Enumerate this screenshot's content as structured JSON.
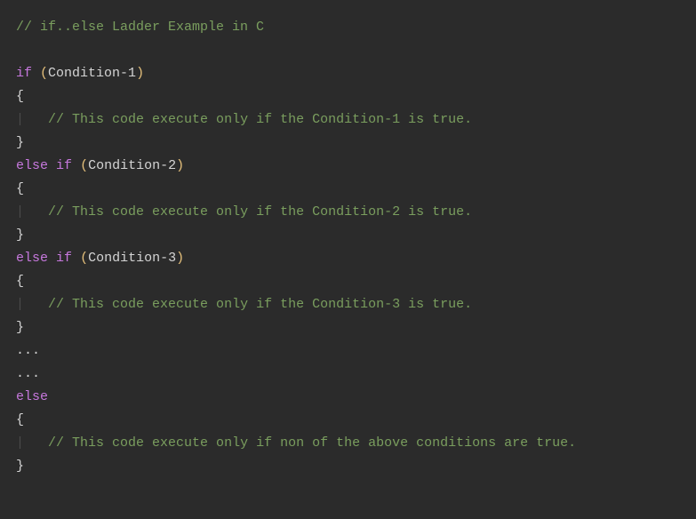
{
  "code": {
    "lines": [
      {
        "tokens": [
          {
            "cls": "comment",
            "text": "// if..else Ladder Example in C"
          }
        ]
      },
      {
        "tokens": []
      },
      {
        "tokens": [
          {
            "cls": "keyword",
            "text": "if"
          },
          {
            "cls": "default",
            "text": " "
          },
          {
            "cls": "paren",
            "text": "("
          },
          {
            "cls": "identifier",
            "text": "Condition-1"
          },
          {
            "cls": "paren",
            "text": ")"
          }
        ]
      },
      {
        "tokens": [
          {
            "cls": "brace",
            "text": "{"
          }
        ]
      },
      {
        "tokens": [
          {
            "cls": "indent-guide",
            "text": "|"
          },
          {
            "cls": "default",
            "text": "   "
          },
          {
            "cls": "comment",
            "text": "// This code execute only if the Condition-1 is true."
          }
        ]
      },
      {
        "tokens": [
          {
            "cls": "brace",
            "text": "}"
          }
        ]
      },
      {
        "tokens": [
          {
            "cls": "keyword",
            "text": "else"
          },
          {
            "cls": "default",
            "text": " "
          },
          {
            "cls": "keyword",
            "text": "if"
          },
          {
            "cls": "default",
            "text": " "
          },
          {
            "cls": "paren",
            "text": "("
          },
          {
            "cls": "identifier",
            "text": "Condition-2"
          },
          {
            "cls": "paren",
            "text": ")"
          }
        ]
      },
      {
        "tokens": [
          {
            "cls": "brace",
            "text": "{"
          }
        ]
      },
      {
        "tokens": [
          {
            "cls": "indent-guide",
            "text": "|"
          },
          {
            "cls": "default",
            "text": "   "
          },
          {
            "cls": "comment",
            "text": "// This code execute only if the Condition-2 is true."
          }
        ]
      },
      {
        "tokens": [
          {
            "cls": "brace",
            "text": "}"
          }
        ]
      },
      {
        "tokens": [
          {
            "cls": "keyword",
            "text": "else"
          },
          {
            "cls": "default",
            "text": " "
          },
          {
            "cls": "keyword",
            "text": "if"
          },
          {
            "cls": "default",
            "text": " "
          },
          {
            "cls": "paren",
            "text": "("
          },
          {
            "cls": "identifier",
            "text": "Condition-3"
          },
          {
            "cls": "paren",
            "text": ")"
          }
        ]
      },
      {
        "tokens": [
          {
            "cls": "brace",
            "text": "{"
          }
        ]
      },
      {
        "tokens": [
          {
            "cls": "indent-guide",
            "text": "|"
          },
          {
            "cls": "default",
            "text": "   "
          },
          {
            "cls": "comment",
            "text": "// This code execute only if the Condition-3 is true."
          }
        ]
      },
      {
        "tokens": [
          {
            "cls": "brace",
            "text": "}"
          }
        ]
      },
      {
        "tokens": [
          {
            "cls": "default",
            "text": "..."
          }
        ]
      },
      {
        "tokens": [
          {
            "cls": "default",
            "text": "..."
          }
        ]
      },
      {
        "tokens": [
          {
            "cls": "keyword",
            "text": "else"
          }
        ]
      },
      {
        "tokens": [
          {
            "cls": "brace",
            "text": "{"
          }
        ]
      },
      {
        "tokens": [
          {
            "cls": "indent-guide",
            "text": "|"
          },
          {
            "cls": "default",
            "text": "   "
          },
          {
            "cls": "comment",
            "text": "// This code execute only if non of the above conditions are true."
          }
        ]
      },
      {
        "tokens": [
          {
            "cls": "brace",
            "text": "}"
          }
        ]
      }
    ]
  }
}
